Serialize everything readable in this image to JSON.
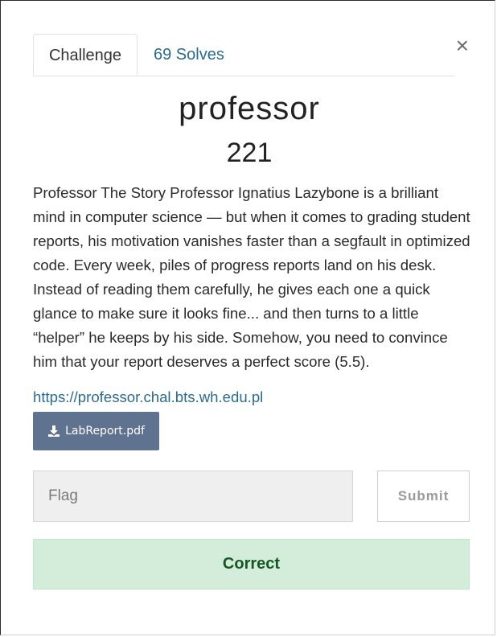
{
  "tabs": {
    "challenge_label": "Challenge",
    "solves_label": "69 Solves"
  },
  "close_label": "×",
  "challenge": {
    "name": "professor",
    "points": "221",
    "description": "Professor The Story Professor Ignatius Lazybone is a brilliant mind in computer science — but when it comes to grading student reports, his motivation vanishes faster than a segfault in optimized code. Every week, piles of progress reports land on his desk. Instead of reading them carefully, he gives each one a quick glance to make sure it looks fine... and then turns to a little “helper” he keeps by his side. Somehow, you need to convince him that your report deserves a perfect score (5.5).",
    "link": "https://professor.chal.bts.wh.edu.pl",
    "file_label": "LabReport.pdf",
    "file_icon": "download-icon"
  },
  "form": {
    "flag_placeholder": "Flag",
    "flag_value": "",
    "submit_label": "Submit"
  },
  "result": {
    "message": "Correct",
    "color_bg": "#d4edda",
    "color_text": "#155724"
  },
  "colors": {
    "link": "#2b6b8f",
    "file_button": "#5f7390"
  }
}
